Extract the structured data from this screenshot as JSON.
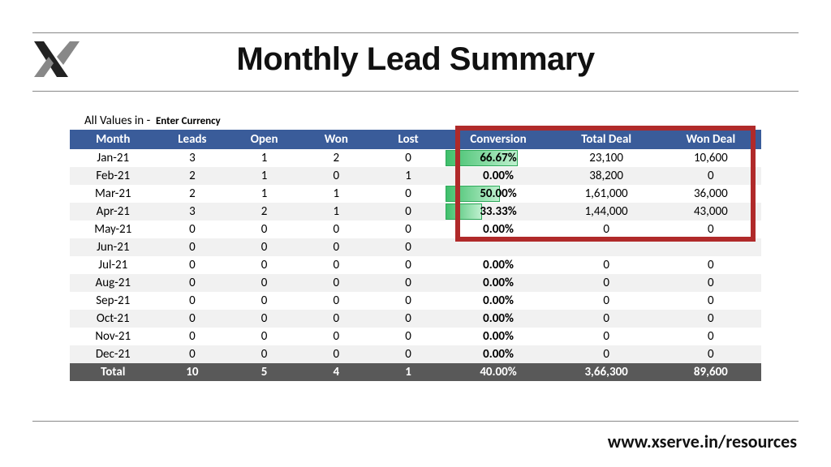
{
  "header": {
    "title": "Monthly Lead Summary"
  },
  "table": {
    "prelabel": "All Values in -",
    "currency_placeholder": "Enter Currency",
    "columns": [
      "Month",
      "Leads",
      "Open",
      "Won",
      "Lost",
      "Conversion",
      "Total Deal",
      "Won Deal"
    ],
    "rows": [
      {
        "month": "Jan-21",
        "leads": "3",
        "open": "1",
        "won": "2",
        "lost": "0",
        "conv": "66.67%",
        "conv_pct": 66.67,
        "total_deal": "23,100",
        "won_deal": "10,600"
      },
      {
        "month": "Feb-21",
        "leads": "2",
        "open": "1",
        "won": "0",
        "lost": "1",
        "conv": "0.00%",
        "conv_pct": 0,
        "total_deal": "38,200",
        "won_deal": "0"
      },
      {
        "month": "Mar-21",
        "leads": "2",
        "open": "1",
        "won": "1",
        "lost": "0",
        "conv": "50.00%",
        "conv_pct": 50,
        "total_deal": "1,61,000",
        "won_deal": "36,000"
      },
      {
        "month": "Apr-21",
        "leads": "3",
        "open": "2",
        "won": "1",
        "lost": "0",
        "conv": "33.33%",
        "conv_pct": 33.33,
        "total_deal": "1,44,000",
        "won_deal": "43,000"
      },
      {
        "month": "May-21",
        "leads": "0",
        "open": "0",
        "won": "0",
        "lost": "0",
        "conv": "0.00%",
        "conv_pct": 0,
        "total_deal": "0",
        "won_deal": "0"
      },
      {
        "month": "Jun-21",
        "leads": "0",
        "open": "0",
        "won": "0",
        "lost": "0",
        "conv": "",
        "conv_pct": 0,
        "total_deal": "",
        "won_deal": ""
      },
      {
        "month": "Jul-21",
        "leads": "0",
        "open": "0",
        "won": "0",
        "lost": "0",
        "conv": "0.00%",
        "conv_pct": 0,
        "total_deal": "0",
        "won_deal": "0"
      },
      {
        "month": "Aug-21",
        "leads": "0",
        "open": "0",
        "won": "0",
        "lost": "0",
        "conv": "0.00%",
        "conv_pct": 0,
        "total_deal": "0",
        "won_deal": "0"
      },
      {
        "month": "Sep-21",
        "leads": "0",
        "open": "0",
        "won": "0",
        "lost": "0",
        "conv": "0.00%",
        "conv_pct": 0,
        "total_deal": "0",
        "won_deal": "0"
      },
      {
        "month": "Oct-21",
        "leads": "0",
        "open": "0",
        "won": "0",
        "lost": "0",
        "conv": "0.00%",
        "conv_pct": 0,
        "total_deal": "0",
        "won_deal": "0"
      },
      {
        "month": "Nov-21",
        "leads": "0",
        "open": "0",
        "won": "0",
        "lost": "0",
        "conv": "0.00%",
        "conv_pct": 0,
        "total_deal": "0",
        "won_deal": "0"
      },
      {
        "month": "Dec-21",
        "leads": "0",
        "open": "0",
        "won": "0",
        "lost": "0",
        "conv": "0.00%",
        "conv_pct": 0,
        "total_deal": "0",
        "won_deal": "0"
      }
    ],
    "total": {
      "month": "Total",
      "leads": "10",
      "open": "5",
      "won": "4",
      "lost": "1",
      "conv": "40.00%",
      "total_deal": "3,66,300",
      "won_deal": "89,600"
    }
  },
  "footer": {
    "url": "www.xserve.in/resources"
  }
}
